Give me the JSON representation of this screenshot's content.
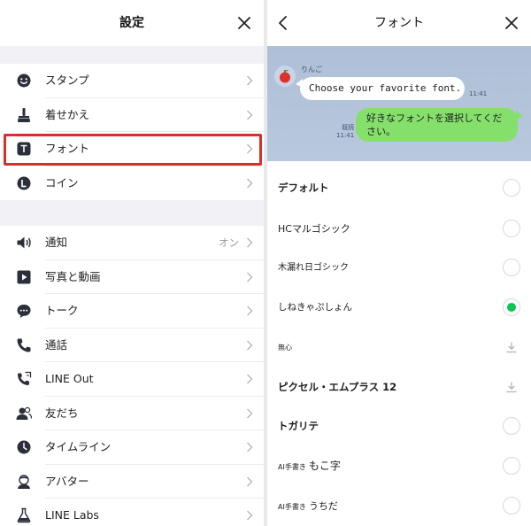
{
  "left": {
    "header": {
      "title": "設定",
      "close_icon": "close-icon"
    },
    "rows": [
      {
        "id": "stamp",
        "label": "スタンプ",
        "icon": "smiley-icon",
        "value": ""
      },
      {
        "id": "theme",
        "label": "着せかえ",
        "icon": "brush-icon",
        "value": ""
      },
      {
        "id": "font",
        "label": "フォント",
        "icon": "font-icon",
        "value": ""
      },
      {
        "id": "coin",
        "label": "コイン",
        "icon": "coin-icon",
        "value": ""
      },
      {
        "id": "notify",
        "label": "通知",
        "icon": "speaker-icon",
        "value": "オン"
      },
      {
        "id": "media",
        "label": "写真と動画",
        "icon": "play-icon",
        "value": ""
      },
      {
        "id": "talk",
        "label": "トーク",
        "icon": "chat-icon",
        "value": ""
      },
      {
        "id": "call",
        "label": "通話",
        "icon": "phone-icon",
        "value": ""
      },
      {
        "id": "lineout",
        "label": "LINE Out",
        "icon": "phone-out-icon",
        "value": ""
      },
      {
        "id": "friends",
        "label": "友だち",
        "icon": "friends-icon",
        "value": ""
      },
      {
        "id": "timeline",
        "label": "タイムライン",
        "icon": "clock-icon",
        "value": ""
      },
      {
        "id": "avatar",
        "label": "アバター",
        "icon": "avatar-icon",
        "value": ""
      },
      {
        "id": "labs",
        "label": "LINE Labs",
        "icon": "flask-icon",
        "value": ""
      }
    ]
  },
  "right": {
    "header": {
      "title": "フォント",
      "back_icon": "back-icon",
      "close_icon": "close-icon"
    },
    "preview": {
      "sender": "りんご",
      "incoming_text": "Choose your favorite font.",
      "incoming_time": "11:41",
      "read_label": "既読",
      "outgoing_time": "11:41",
      "outgoing_text": "好きなフォントを選択してください。"
    },
    "fonts": [
      {
        "name": "デフォルト",
        "prefix": "",
        "state": "radio"
      },
      {
        "name": "HCマルゴシック",
        "prefix": "",
        "state": "radio"
      },
      {
        "name": "木漏れ日ゴシック",
        "prefix": "",
        "state": "radio"
      },
      {
        "name": "しねきゃぷしょん",
        "prefix": "",
        "state": "selected"
      },
      {
        "name": "無心",
        "prefix": "",
        "state": "download"
      },
      {
        "name": "ピクセル・エムプラス 12",
        "prefix": "",
        "state": "download"
      },
      {
        "name": "トガリテ",
        "prefix": "",
        "state": "radio"
      },
      {
        "name": "もこ字",
        "prefix": "AI手書き",
        "state": "radio"
      },
      {
        "name": "うちだ",
        "prefix": "AI手書き",
        "state": "radio"
      }
    ]
  },
  "colors": {
    "highlight": "#d92e2a",
    "selected_radio": "#06c755",
    "outgoing_bubble": "#84e06b",
    "section_gap": "#f2f2f6"
  }
}
